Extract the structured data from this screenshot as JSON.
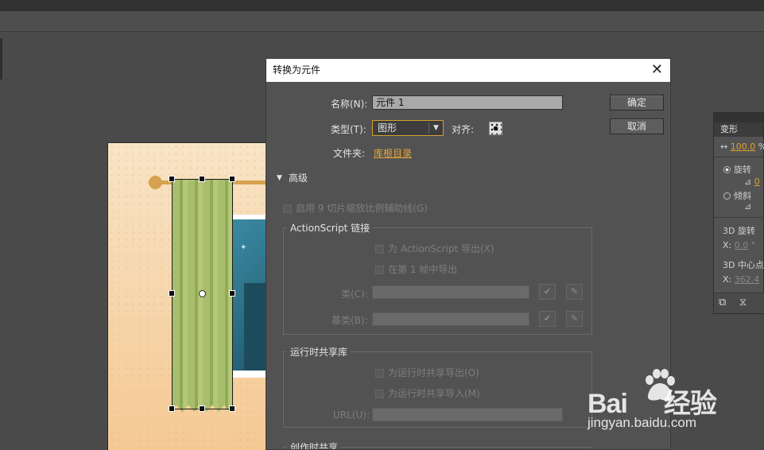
{
  "dialog": {
    "title": "转换为元件",
    "name_label": "名称(N):",
    "name_value": "元件 1",
    "type_label": "类型(T):",
    "type_value": "图形",
    "align_label": "对齐:",
    "folder_label": "文件夹:",
    "folder_value": "库根目录",
    "ok": "确定",
    "cancel": "取消",
    "advanced": "高级",
    "nine_slice": "启用 9 切片缩放比例辅助线(G)",
    "actionscript_group": "ActionScript 链接",
    "export_as": "为 ActionScript 导出(X)",
    "export_frame1": "在第 1 帧中导出",
    "class_label": "类(C):",
    "base_class_label": "基类(B):",
    "runtime_group": "运行时共享库",
    "runtime_export": "为运行时共享导出(O)",
    "runtime_import": "为运行时共享导入(M)",
    "url_label": "URL(U):",
    "authoring_group": "创作时共享"
  },
  "transform_panel": {
    "tab": "变形",
    "scale_value": "100.0",
    "scale_unit": "%",
    "rotate": "旋转",
    "rotate_value": "0",
    "skew": "倾斜",
    "rotate3d": "3D 旋转",
    "x_label": "X:",
    "x_rot_value": "0.0",
    "x_rot_unit": "°",
    "center3d": "3D 中心点",
    "x_center_value": "362.4"
  },
  "watermark": {
    "brand": "Bai",
    "brand_tail": "经验",
    "url": "jingyan.baidu.com"
  }
}
